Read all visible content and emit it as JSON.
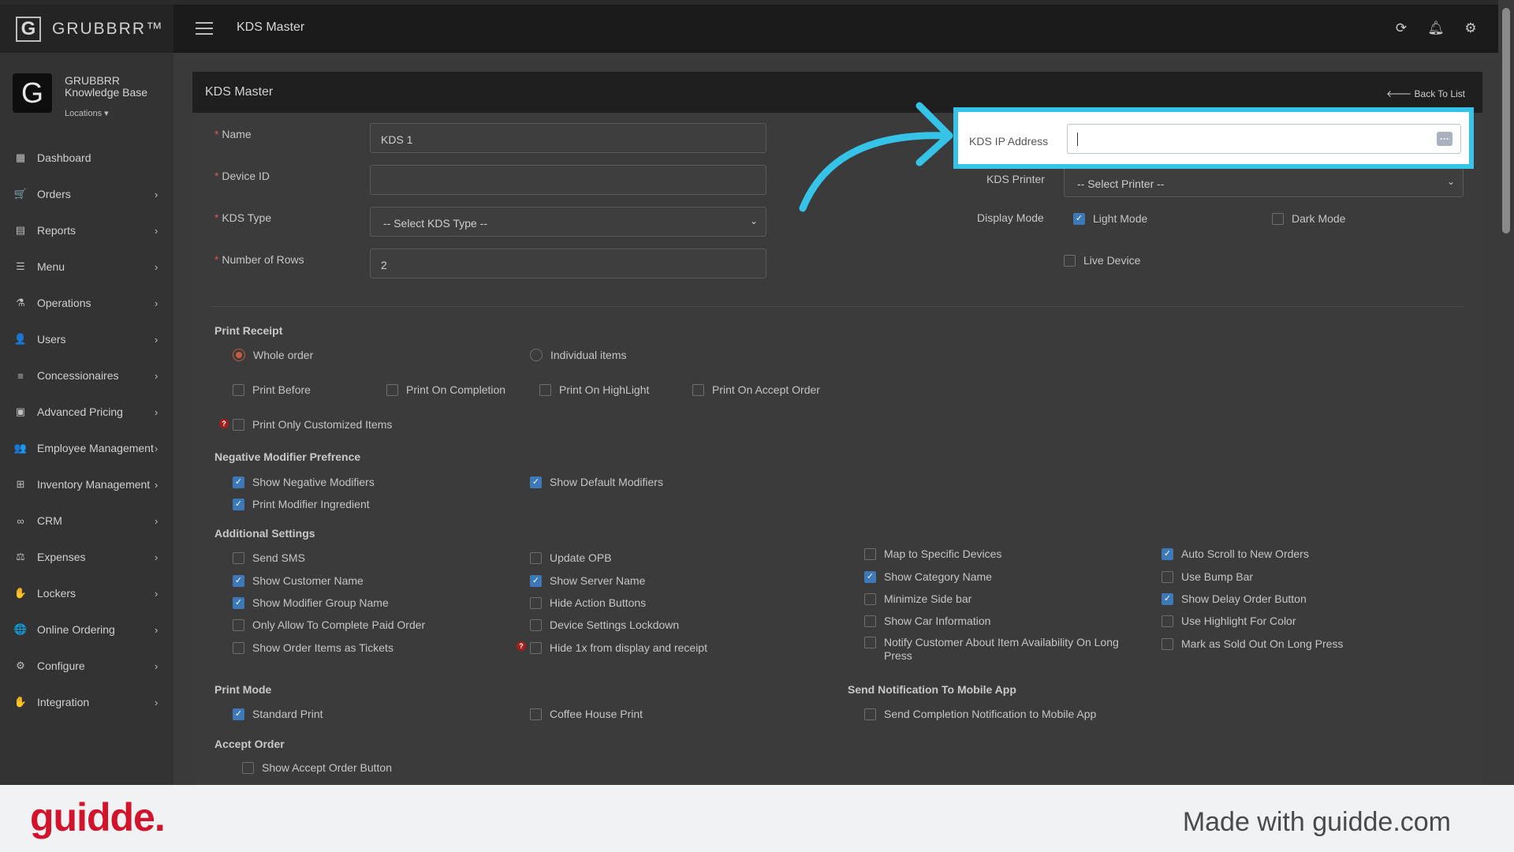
{
  "app": {
    "brand": "GRUBBRR™",
    "page_title": "KDS Master",
    "profile_name": "GRUBBRR Knowledge Base",
    "locations_label": "Locations ▾"
  },
  "sidebar": {
    "items": [
      {
        "label": "Dashboard",
        "icon": "dashboard-icon",
        "glyph": "▦",
        "has_arrow": false
      },
      {
        "label": "Orders",
        "icon": "cart-icon",
        "glyph": "🛒",
        "has_arrow": true
      },
      {
        "label": "Reports",
        "icon": "report-icon",
        "glyph": "▤",
        "has_arrow": true
      },
      {
        "label": "Menu",
        "icon": "menu-list-icon",
        "glyph": "☰",
        "has_arrow": true
      },
      {
        "label": "Operations",
        "icon": "flask-icon",
        "glyph": "⚗",
        "has_arrow": true
      },
      {
        "label": "Users",
        "icon": "user-add-icon",
        "glyph": "👤",
        "has_arrow": true
      },
      {
        "label": "Concessionaires",
        "icon": "list-icon",
        "glyph": "≡",
        "has_arrow": true
      },
      {
        "label": "Advanced Pricing",
        "icon": "money-icon",
        "glyph": "▣",
        "has_arrow": true
      },
      {
        "label": "Employee Management",
        "icon": "group-icon",
        "glyph": "👥",
        "has_arrow": true
      },
      {
        "label": "Inventory Management",
        "icon": "sitemap-icon",
        "glyph": "⊞",
        "has_arrow": true
      },
      {
        "label": "CRM",
        "icon": "link-icon",
        "glyph": "∞",
        "has_arrow": true
      },
      {
        "label": "Expenses",
        "icon": "scale-icon",
        "glyph": "⚖",
        "has_arrow": true
      },
      {
        "label": "Lockers",
        "icon": "locker-icon",
        "glyph": "✋",
        "has_arrow": true
      },
      {
        "label": "Online Ordering",
        "icon": "globe-icon",
        "glyph": "🌐",
        "has_arrow": true
      },
      {
        "label": "Configure",
        "icon": "gear-icon",
        "glyph": "⚙",
        "has_arrow": true
      },
      {
        "label": "Integration",
        "icon": "plug-icon",
        "glyph": "✋",
        "has_arrow": true
      }
    ]
  },
  "panel": {
    "title": "KDS Master",
    "back_label": "🡐 Back To List"
  },
  "form": {
    "name_label": "Name",
    "name_value": "KDS 1",
    "device_id_label": "Device ID",
    "device_id_value": "",
    "kds_type_label": "KDS Type",
    "kds_type_value": "-- Select KDS Type --",
    "rows_label": "Number of Rows",
    "rows_value": "2",
    "ip_label": "KDS IP Address",
    "ip_value": "",
    "printer_label": "KDS Printer",
    "printer_value": "-- Select Printer --",
    "display_mode_label": "Display Mode",
    "light_mode": {
      "label": "Light Mode",
      "checked": true
    },
    "dark_mode": {
      "label": "Dark Mode",
      "checked": false
    },
    "live_device": {
      "label": "Live Device",
      "checked": false
    },
    "required_mark": "*"
  },
  "print_receipt": {
    "title": "Print Receipt",
    "whole_order": {
      "label": "Whole order",
      "selected": true
    },
    "individual_items": {
      "label": "Individual items",
      "selected": false
    },
    "print_before": {
      "label": "Print Before",
      "checked": false
    },
    "print_on_completion": {
      "label": "Print On Completion",
      "checked": false
    },
    "print_on_highlight": {
      "label": "Print On HighLight",
      "checked": false
    },
    "print_on_accept": {
      "label": "Print On Accept Order",
      "checked": false
    },
    "print_only_customized": {
      "label": "Print Only Customized Items",
      "checked": false
    }
  },
  "negative_modifier": {
    "title": "Negative Modifier Prefrence",
    "show_negative": {
      "label": "Show Negative Modifiers",
      "checked": true
    },
    "show_default": {
      "label": "Show Default Modifiers",
      "checked": true
    },
    "print_ingredient": {
      "label": "Print Modifier Ingredient",
      "checked": true
    }
  },
  "additional": {
    "title": "Additional Settings",
    "send_sms": {
      "label": "Send SMS",
      "checked": false
    },
    "show_customer_name": {
      "label": "Show Customer Name",
      "checked": true
    },
    "show_modifier_group": {
      "label": "Show Modifier Group Name",
      "checked": true
    },
    "only_allow_complete": {
      "label": "Only Allow To Complete Paid Order",
      "checked": false
    },
    "show_order_items_tickets": {
      "label": "Show Order Items as Tickets",
      "checked": false
    },
    "update_opb": {
      "label": "Update OPB",
      "checked": false
    },
    "show_server_name": {
      "label": "Show Server Name",
      "checked": true
    },
    "hide_action_buttons": {
      "label": "Hide Action Buttons",
      "checked": false
    },
    "device_settings_lockdown": {
      "label": "Device Settings Lockdown",
      "checked": false
    },
    "hide_1x": {
      "label": "Hide 1x from display and receipt",
      "checked": false
    },
    "map_specific_devices": {
      "label": "Map to Specific Devices",
      "checked": false
    },
    "show_category_name": {
      "label": "Show Category Name",
      "checked": true
    },
    "minimize_side_bar": {
      "label": "Minimize Side bar",
      "checked": false
    },
    "show_car_info": {
      "label": "Show Car Information",
      "checked": false
    },
    "notify_customer": {
      "label": "Notify Customer About Item Availability On Long Press",
      "checked": false
    },
    "auto_scroll": {
      "label": "Auto Scroll to New Orders",
      "checked": true
    },
    "use_bump_bar": {
      "label": "Use Bump Bar",
      "checked": false
    },
    "show_delay_button": {
      "label": "Show Delay Order Button",
      "checked": true
    },
    "use_highlight_color": {
      "label": "Use Highlight For Color",
      "checked": false
    },
    "mark_sold_out": {
      "label": "Mark as Sold Out On Long Press",
      "checked": false
    }
  },
  "print_mode": {
    "title": "Print Mode",
    "standard_print": {
      "label": "Standard Print",
      "checked": true
    },
    "coffee_house_print": {
      "label": "Coffee House Print",
      "checked": false
    }
  },
  "notification": {
    "title": "Send Notification To Mobile App",
    "send_completion": {
      "label": "Send Completion Notification to Mobile App",
      "checked": false
    }
  },
  "accept_order": {
    "title": "Accept Order",
    "show_accept_button": {
      "label": "Show Accept Order Button",
      "checked": false
    }
  },
  "footer": {
    "logo": "guidde.",
    "made_with": "Made with guidde.com"
  },
  "colors": {
    "highlight": "#36c3e8",
    "checkbox_on": "#3d78b8",
    "radio_on": "#c45a3c",
    "guidde_red": "#d1142b"
  }
}
